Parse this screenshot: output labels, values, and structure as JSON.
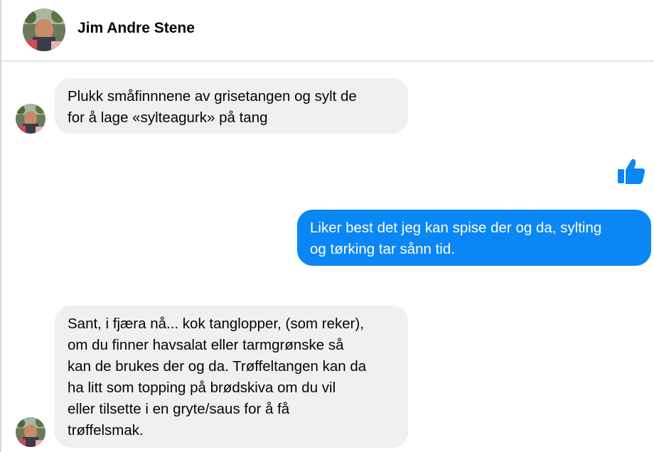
{
  "header": {
    "contact_name": "Jim Andre Stene",
    "avatar_icon": "profile-photo-avatar"
  },
  "colors": {
    "incoming_bubble": "#f0f0f0",
    "outgoing_bubble": "#0b86f5",
    "like_icon": "#0b86f5"
  },
  "messages": [
    {
      "direction": "incoming",
      "lines": [
        "Plukk småfinnnene av grisetangen og sylt de",
        "for å lage «sylteagurk» på tang"
      ]
    },
    {
      "direction": "outgoing",
      "type": "like",
      "icon": "thumbs-up-icon"
    },
    {
      "direction": "outgoing",
      "lines": [
        "Liker best det jeg kan spise der og da, sylting",
        "og tørking tar sånn tid."
      ]
    },
    {
      "direction": "incoming",
      "lines": [
        "Sant, i fjæra nå... kok tanglopper, (som reker),",
        "om du finner havsalat eller tarmgrønske så",
        "kan de brukes der og da. Trøffeltangen kan da",
        "ha litt som topping på brødskiva om du vil",
        "eller tilsette i en gryte/saus for å få",
        "trøffelsmak."
      ]
    }
  ]
}
